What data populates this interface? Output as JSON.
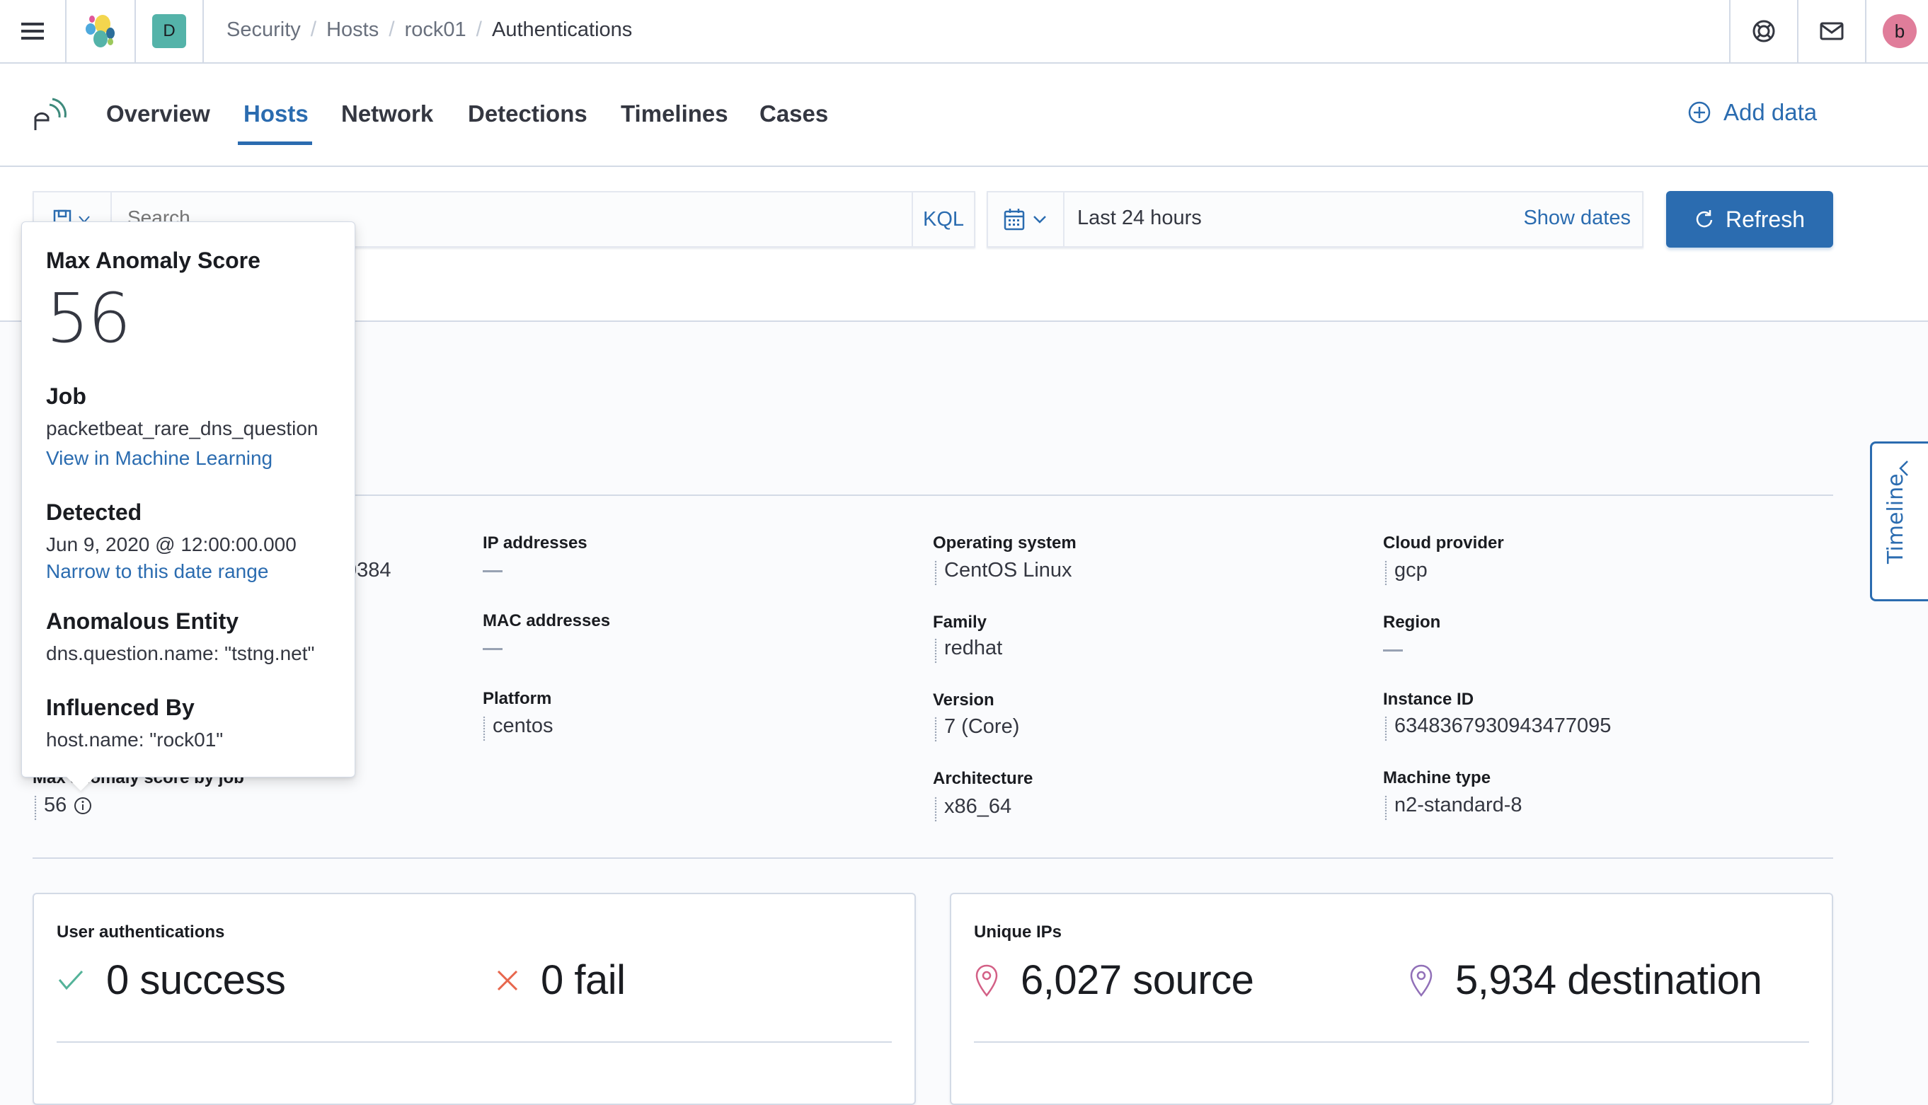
{
  "header": {
    "menu_icon": "hamburger-icon",
    "logo_icon": "elastic-logo-icon",
    "space_badge": "D",
    "breadcrumbs": [
      "Security",
      "Hosts",
      "rock01",
      "Authentications"
    ],
    "help_icon": "help-lifebuoy-icon",
    "news_icon": "mail-icon",
    "user_avatar": "b",
    "colors": {
      "space_badge": "#54b3a9",
      "avatar": "#e07d9a"
    }
  },
  "nav": {
    "app_icon": "siem-app-icon",
    "tabs": [
      {
        "label": "Overview",
        "active": false
      },
      {
        "label": "Hosts",
        "active": true
      },
      {
        "label": "Network",
        "active": false
      },
      {
        "label": "Detections",
        "active": false
      },
      {
        "label": "Timelines",
        "active": false
      },
      {
        "label": "Cases",
        "active": false
      }
    ],
    "add_data_label": "Add data"
  },
  "search": {
    "placeholder": "Search",
    "language": "KQL",
    "date_range": "Last 24 hours",
    "show_dates_label": "Show dates",
    "refresh_label": "Refresh"
  },
  "host_details": {
    "partial_value": "0384",
    "columns": [
      [
        {
          "label": "IP addresses",
          "value": null
        },
        {
          "label": "MAC addresses",
          "value": null
        },
        {
          "label": "Platform",
          "value": "centos"
        }
      ],
      [
        {
          "label": "Operating system",
          "value": "CentOS Linux"
        },
        {
          "label": "Family",
          "value": "redhat"
        },
        {
          "label": "Version",
          "value": "7 (Core)"
        },
        {
          "label": "Architecture",
          "value": "x86_64"
        }
      ],
      [
        {
          "label": "Cloud provider",
          "value": "gcp"
        },
        {
          "label": "Region",
          "value": null
        },
        {
          "label": "Instance ID",
          "value": "6348367930943477095"
        },
        {
          "label": "Machine type",
          "value": "n2-standard-8"
        }
      ]
    ],
    "anomaly_label": "Max anomaly score by job",
    "anomaly_value": "56"
  },
  "popover": {
    "title": "Max Anomaly Score",
    "score": "56",
    "job_heading": "Job",
    "job_name": "packetbeat_rare_dns_question",
    "job_link": "View in Machine Learning",
    "detected_heading": "Detected",
    "detected_value": "Jun 9, 2020 @ 12:00:00.000",
    "detected_link": "Narrow to this date range",
    "entity_heading": "Anomalous Entity",
    "entity_value": "dns.question.name: \"tstng.net\"",
    "influenced_heading": "Influenced By",
    "influenced_value": "host.name: \"rock01\""
  },
  "cards": {
    "auth": {
      "title": "User authentications",
      "success": "0 success",
      "fail": "0 fail",
      "colors": {
        "success": "#54b399",
        "fail": "#e7664c"
      }
    },
    "ips": {
      "title": "Unique IPs",
      "source": "6,027 source",
      "destination": "5,934 destination",
      "colors": {
        "source": "#d36086",
        "destination": "#9170b8"
      }
    }
  },
  "timeline_tab": {
    "label": "Timeline"
  },
  "theme": {
    "accent": "#2b6cb0",
    "text": "#343741",
    "border": "#d3dae6"
  }
}
